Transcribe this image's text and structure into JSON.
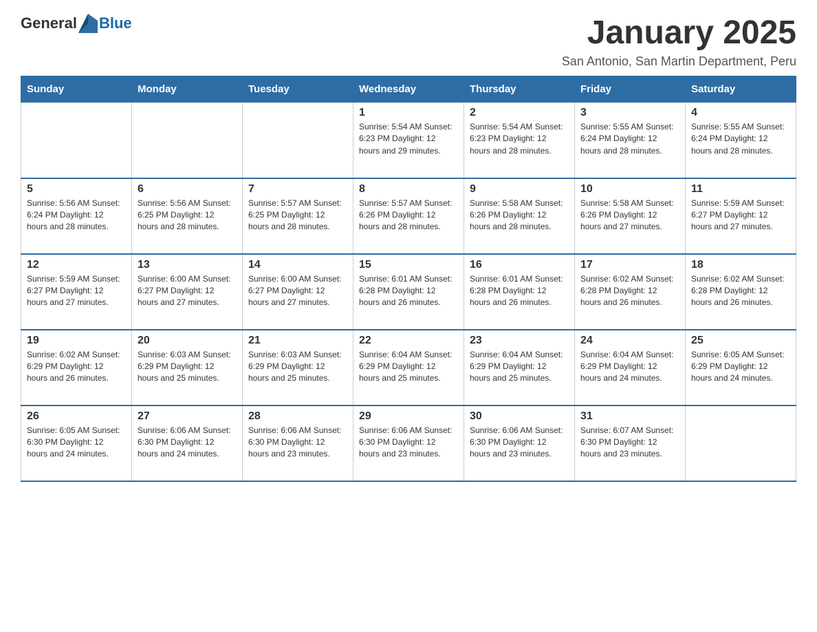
{
  "header": {
    "logo_general": "General",
    "logo_blue": "Blue",
    "title": "January 2025",
    "subtitle": "San Antonio, San Martin Department, Peru"
  },
  "days_of_week": [
    "Sunday",
    "Monday",
    "Tuesday",
    "Wednesday",
    "Thursday",
    "Friday",
    "Saturday"
  ],
  "weeks": [
    [
      {
        "day": "",
        "info": ""
      },
      {
        "day": "",
        "info": ""
      },
      {
        "day": "",
        "info": ""
      },
      {
        "day": "1",
        "info": "Sunrise: 5:54 AM\nSunset: 6:23 PM\nDaylight: 12 hours\nand 29 minutes."
      },
      {
        "day": "2",
        "info": "Sunrise: 5:54 AM\nSunset: 6:23 PM\nDaylight: 12 hours\nand 28 minutes."
      },
      {
        "day": "3",
        "info": "Sunrise: 5:55 AM\nSunset: 6:24 PM\nDaylight: 12 hours\nand 28 minutes."
      },
      {
        "day": "4",
        "info": "Sunrise: 5:55 AM\nSunset: 6:24 PM\nDaylight: 12 hours\nand 28 minutes."
      }
    ],
    [
      {
        "day": "5",
        "info": "Sunrise: 5:56 AM\nSunset: 6:24 PM\nDaylight: 12 hours\nand 28 minutes."
      },
      {
        "day": "6",
        "info": "Sunrise: 5:56 AM\nSunset: 6:25 PM\nDaylight: 12 hours\nand 28 minutes."
      },
      {
        "day": "7",
        "info": "Sunrise: 5:57 AM\nSunset: 6:25 PM\nDaylight: 12 hours\nand 28 minutes."
      },
      {
        "day": "8",
        "info": "Sunrise: 5:57 AM\nSunset: 6:26 PM\nDaylight: 12 hours\nand 28 minutes."
      },
      {
        "day": "9",
        "info": "Sunrise: 5:58 AM\nSunset: 6:26 PM\nDaylight: 12 hours\nand 28 minutes."
      },
      {
        "day": "10",
        "info": "Sunrise: 5:58 AM\nSunset: 6:26 PM\nDaylight: 12 hours\nand 27 minutes."
      },
      {
        "day": "11",
        "info": "Sunrise: 5:59 AM\nSunset: 6:27 PM\nDaylight: 12 hours\nand 27 minutes."
      }
    ],
    [
      {
        "day": "12",
        "info": "Sunrise: 5:59 AM\nSunset: 6:27 PM\nDaylight: 12 hours\nand 27 minutes."
      },
      {
        "day": "13",
        "info": "Sunrise: 6:00 AM\nSunset: 6:27 PM\nDaylight: 12 hours\nand 27 minutes."
      },
      {
        "day": "14",
        "info": "Sunrise: 6:00 AM\nSunset: 6:27 PM\nDaylight: 12 hours\nand 27 minutes."
      },
      {
        "day": "15",
        "info": "Sunrise: 6:01 AM\nSunset: 6:28 PM\nDaylight: 12 hours\nand 26 minutes."
      },
      {
        "day": "16",
        "info": "Sunrise: 6:01 AM\nSunset: 6:28 PM\nDaylight: 12 hours\nand 26 minutes."
      },
      {
        "day": "17",
        "info": "Sunrise: 6:02 AM\nSunset: 6:28 PM\nDaylight: 12 hours\nand 26 minutes."
      },
      {
        "day": "18",
        "info": "Sunrise: 6:02 AM\nSunset: 6:28 PM\nDaylight: 12 hours\nand 26 minutes."
      }
    ],
    [
      {
        "day": "19",
        "info": "Sunrise: 6:02 AM\nSunset: 6:29 PM\nDaylight: 12 hours\nand 26 minutes."
      },
      {
        "day": "20",
        "info": "Sunrise: 6:03 AM\nSunset: 6:29 PM\nDaylight: 12 hours\nand 25 minutes."
      },
      {
        "day": "21",
        "info": "Sunrise: 6:03 AM\nSunset: 6:29 PM\nDaylight: 12 hours\nand 25 minutes."
      },
      {
        "day": "22",
        "info": "Sunrise: 6:04 AM\nSunset: 6:29 PM\nDaylight: 12 hours\nand 25 minutes."
      },
      {
        "day": "23",
        "info": "Sunrise: 6:04 AM\nSunset: 6:29 PM\nDaylight: 12 hours\nand 25 minutes."
      },
      {
        "day": "24",
        "info": "Sunrise: 6:04 AM\nSunset: 6:29 PM\nDaylight: 12 hours\nand 24 minutes."
      },
      {
        "day": "25",
        "info": "Sunrise: 6:05 AM\nSunset: 6:29 PM\nDaylight: 12 hours\nand 24 minutes."
      }
    ],
    [
      {
        "day": "26",
        "info": "Sunrise: 6:05 AM\nSunset: 6:30 PM\nDaylight: 12 hours\nand 24 minutes."
      },
      {
        "day": "27",
        "info": "Sunrise: 6:06 AM\nSunset: 6:30 PM\nDaylight: 12 hours\nand 24 minutes."
      },
      {
        "day": "28",
        "info": "Sunrise: 6:06 AM\nSunset: 6:30 PM\nDaylight: 12 hours\nand 23 minutes."
      },
      {
        "day": "29",
        "info": "Sunrise: 6:06 AM\nSunset: 6:30 PM\nDaylight: 12 hours\nand 23 minutes."
      },
      {
        "day": "30",
        "info": "Sunrise: 6:06 AM\nSunset: 6:30 PM\nDaylight: 12 hours\nand 23 minutes."
      },
      {
        "day": "31",
        "info": "Sunrise: 6:07 AM\nSunset: 6:30 PM\nDaylight: 12 hours\nand 23 minutes."
      },
      {
        "day": "",
        "info": ""
      }
    ]
  ]
}
